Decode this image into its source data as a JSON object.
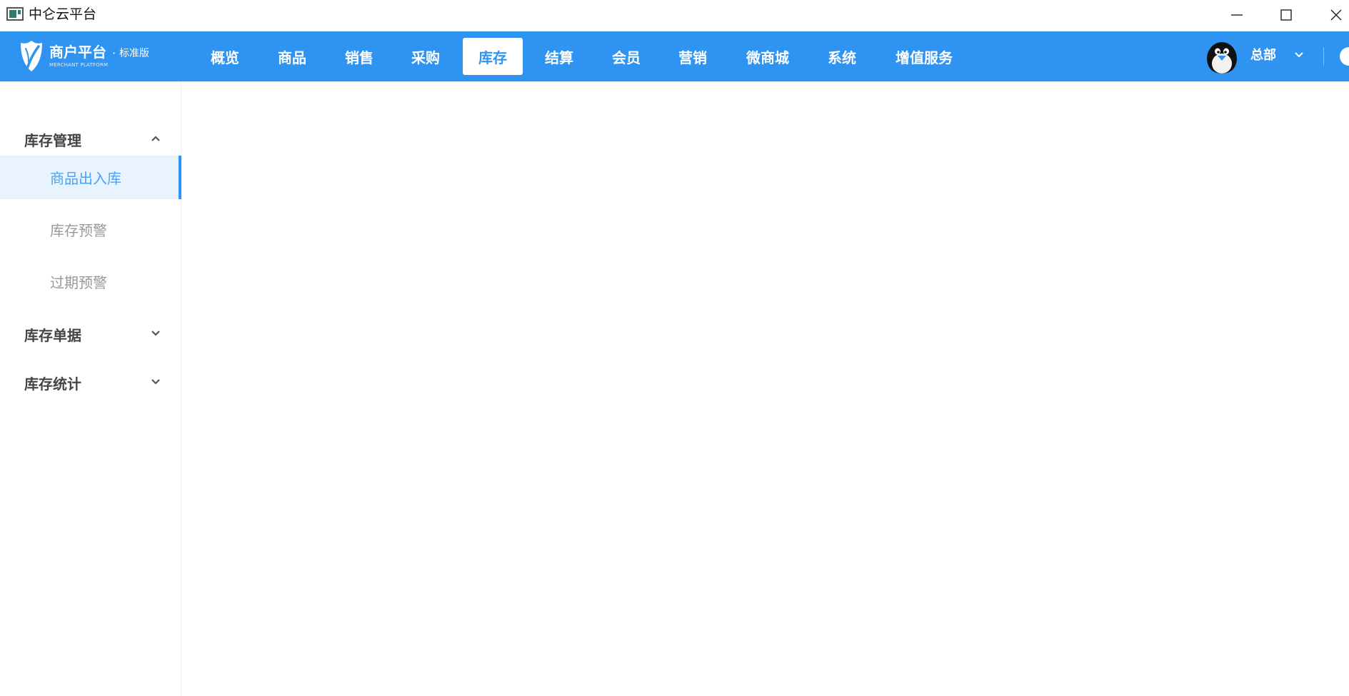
{
  "window": {
    "title": "中仑云平台"
  },
  "brand": {
    "name": "商户平台",
    "separator": "·",
    "edition": "标准版",
    "subtitle": "MERCHANT PLATFORM"
  },
  "nav": {
    "items": [
      {
        "label": "概览"
      },
      {
        "label": "商品"
      },
      {
        "label": "销售"
      },
      {
        "label": "采购"
      },
      {
        "label": "库存"
      },
      {
        "label": "结算"
      },
      {
        "label": "会员"
      },
      {
        "label": "营销"
      },
      {
        "label": "微商城"
      },
      {
        "label": "系统"
      },
      {
        "label": "增值服务"
      }
    ],
    "active": "库存"
  },
  "user": {
    "name": "总部"
  },
  "sidebar": {
    "groups": [
      {
        "label": "库存管理",
        "expanded": true,
        "items": [
          {
            "label": "商品出入库",
            "active": true
          },
          {
            "label": "库存预警",
            "active": false
          },
          {
            "label": "过期预警",
            "active": false
          }
        ]
      },
      {
        "label": "库存单据",
        "expanded": false
      },
      {
        "label": "库存统计",
        "expanded": false
      }
    ]
  },
  "colors": {
    "primary": "#2f93f2",
    "active_bg": "#e8f3fe",
    "active_text": "#4aa3f5",
    "inactive_text": "#999999"
  }
}
